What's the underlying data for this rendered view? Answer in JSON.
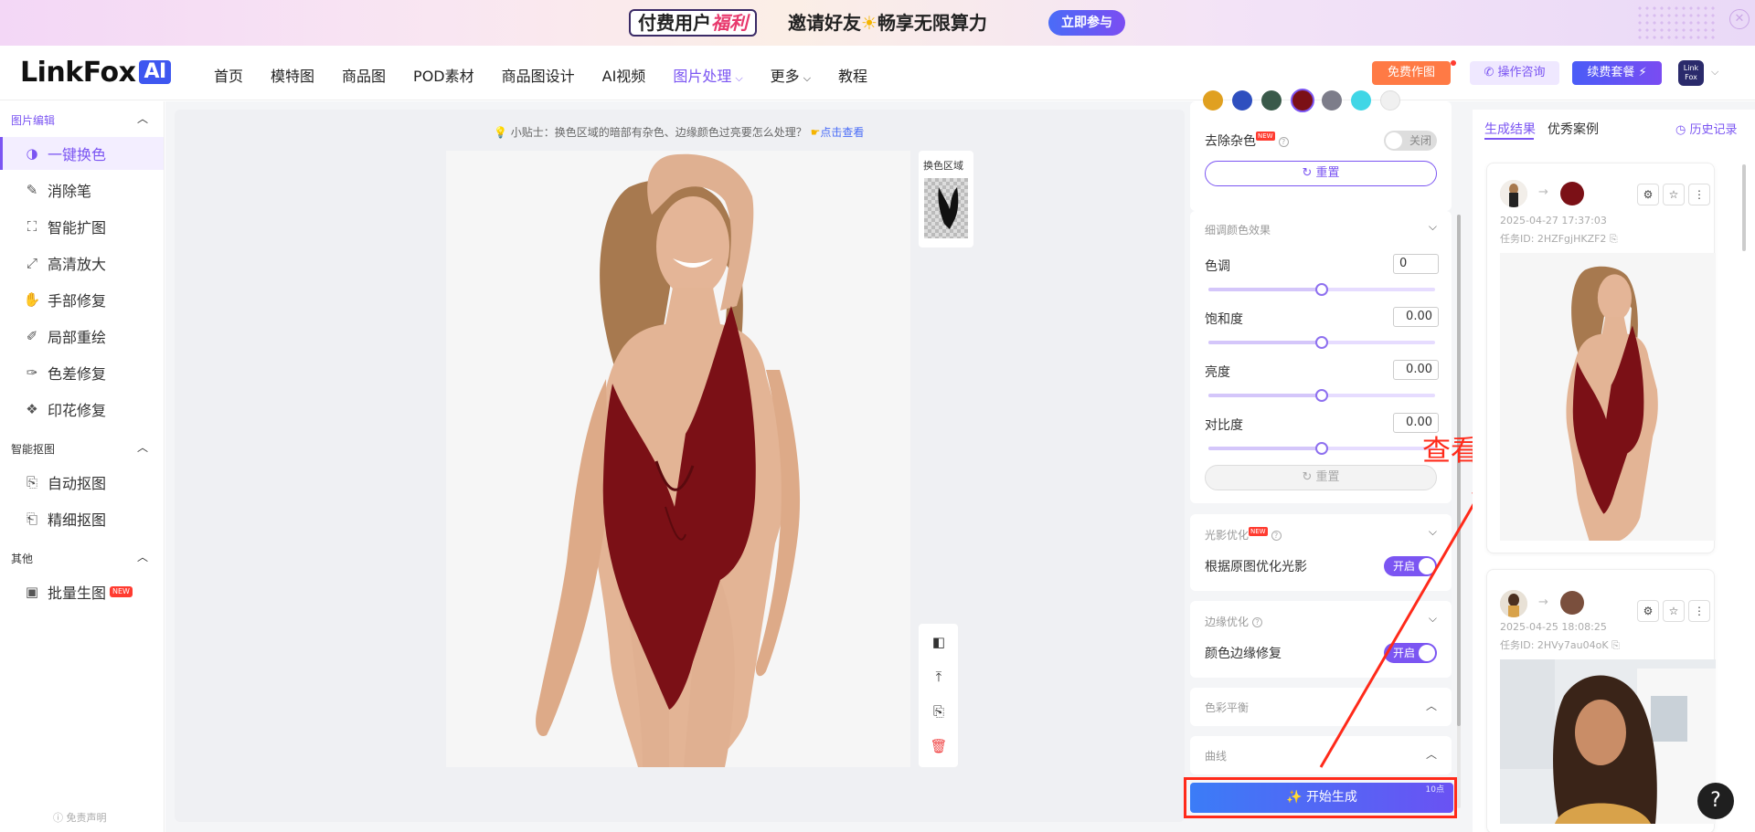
{
  "banner": {
    "part1_a": "付费用户",
    "part1_b": "福利",
    "part2_a": "邀请好友",
    "part2_b": "畅享无限算力",
    "cta": "立即参与"
  },
  "nav": {
    "logo": "LinkFox",
    "logo_ai": "AI",
    "items": [
      "首页",
      "模特图",
      "商品图",
      "POD素材",
      "商品图设计",
      "AI视频",
      "图片处理",
      "更多",
      "教程"
    ],
    "free_btn": "免费作图",
    "consult_btn": "操作咨询",
    "renew_btn": "续费套餐",
    "avatar_text": "Link Fox"
  },
  "sidebar": {
    "section1": "图片编辑",
    "items1": [
      "一键换色",
      "消除笔",
      "智能扩图",
      "高清放大",
      "手部修复",
      "局部重绘",
      "色差修复",
      "印花修复"
    ],
    "section2": "智能抠图",
    "items2": [
      "自动抠图",
      "精细抠图"
    ],
    "section3": "其他",
    "items3": [
      "批量生图"
    ],
    "new_badge": "NEW",
    "disclaimer": "免责声明"
  },
  "canvas": {
    "tip_prefix": "小贴士：换色区域的暗部有杂色、边缘颜色过亮要怎么处理？",
    "tip_link": "点击查看",
    "swap_label": "换色区域"
  },
  "settings": {
    "denoise_label": "去除杂色",
    "denoise_state": "关闭",
    "reset_label": "重置",
    "fine_tune_title": "细调颜色效果",
    "hue_label": "色调",
    "hue_value": "0",
    "saturation_label": "饱和度",
    "saturation_value": "0.00",
    "brightness_label": "亮度",
    "brightness_value": "0.00",
    "contrast_label": "对比度",
    "contrast_value": "0.00",
    "slider_levels": [
      0.5,
      0.5,
      0.5,
      0.5
    ],
    "light_title": "光影优化",
    "light_row": "根据原图优化光影",
    "light_state": "开启",
    "edge_title": "边缘优化",
    "edge_row": "颜色边缘修复",
    "edge_state": "开启",
    "balance_title": "色彩平衡",
    "curve_title": "曲线",
    "generate": "开始生成",
    "points": "10点",
    "swatch_colors": [
      "#e0a020",
      "#2f4fbf",
      "#3a5a4a",
      "#7b1016",
      "#7d7d8a",
      "#40d6e6",
      "#f0f0f0"
    ]
  },
  "results": {
    "tab_generated": "生成结果",
    "tab_cases": "优秀案例",
    "history": "历史记录",
    "cards": [
      {
        "date": "2025-04-27 17:37:03",
        "task": "任务ID: 2HZFgjHKZF2",
        "swatch": "#7b1016"
      },
      {
        "date": "2025-04-25 18:08:25",
        "task": "任务ID: 2HVy7au04oK",
        "swatch": "#7a4f3d"
      }
    ]
  },
  "annotation": "查看结果"
}
